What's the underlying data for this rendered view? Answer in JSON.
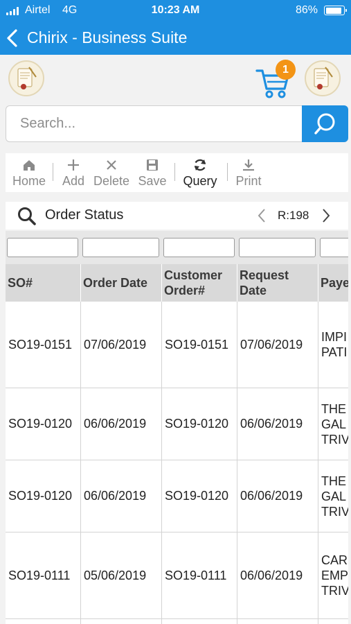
{
  "status_bar": {
    "carrier": "Airtel",
    "network": "4G",
    "time": "10:23 AM",
    "battery": "86%"
  },
  "header": {
    "title": "Chirix - Business Suite"
  },
  "cart": {
    "badge": "1"
  },
  "search": {
    "placeholder": "Search...",
    "value": ""
  },
  "toolbar": {
    "items": [
      {
        "label": "Home",
        "icon": "home-icon"
      },
      {
        "label": "Add",
        "icon": "plus-icon"
      },
      {
        "label": "Delete",
        "icon": "x-icon"
      },
      {
        "label": "Save",
        "icon": "floppy-icon"
      },
      {
        "label": "Query",
        "icon": "refresh-icon"
      },
      {
        "label": "Print",
        "icon": "download-icon"
      }
    ]
  },
  "order_status": {
    "title": "Order Status",
    "record": "R:198"
  },
  "grid": {
    "columns": [
      "SO#",
      "Order Date",
      "Customer\nOrder#",
      "Request\nDate",
      "Paye"
    ],
    "rows": [
      {
        "so": "SO19-0151",
        "order_date": "07/06/2019",
        "customer_order": "SO19-0151",
        "request_date": "07/06/2019",
        "payee": "IMPI\nPATI"
      },
      {
        "so": "SO19-0120",
        "order_date": "06/06/2019",
        "customer_order": "SO19-0120",
        "request_date": "06/06/2019",
        "payee": "THE\nGAL\nTRIV"
      },
      {
        "so": "SO19-0120",
        "order_date": "06/06/2019",
        "customer_order": "SO19-0120",
        "request_date": "06/06/2019",
        "payee": "THE\nGAL\nTRIV"
      },
      {
        "so": "SO19-0111",
        "order_date": "05/06/2019",
        "customer_order": "SO19-0111",
        "request_date": "06/06/2019",
        "payee": "CAR\nEMP\nTRIV"
      }
    ]
  },
  "colors": {
    "brand": "#1e8fe0",
    "badge": "#f39415"
  }
}
